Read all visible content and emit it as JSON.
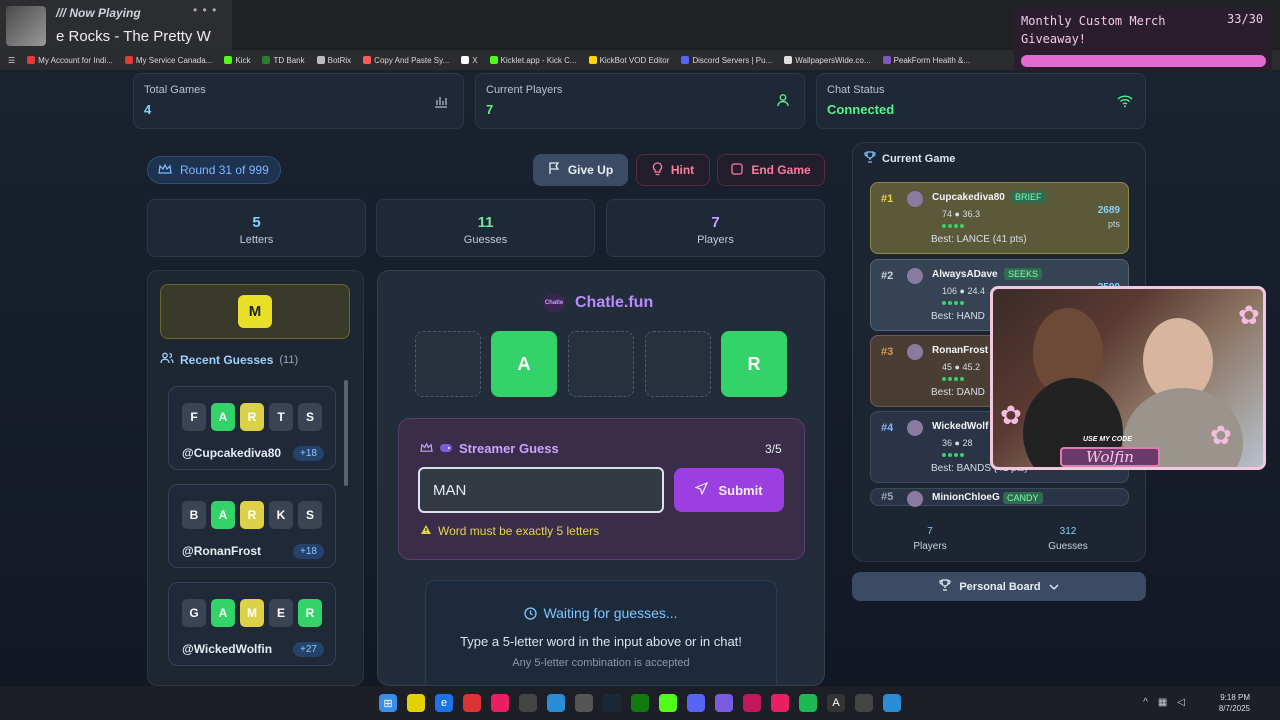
{
  "now_playing": {
    "label": "/// Now Playing",
    "song": "e Rocks - The Pretty W"
  },
  "bookmarks": [
    {
      "label": "My Account for Indi...",
      "color": "#e53935"
    },
    {
      "label": "My Service Canada...",
      "color": "#e53935"
    },
    {
      "label": "Kick",
      "color": "#53fc18"
    },
    {
      "label": "TD Bank",
      "color": "#2e7d32"
    },
    {
      "label": "BotRix",
      "color": "#bbbbbb"
    },
    {
      "label": "Copy And Paste Sy...",
      "color": "#ff5a5a"
    },
    {
      "label": "X",
      "color": "#ffffff"
    },
    {
      "label": "Kicklet.app - Kick C...",
      "color": "#53fc18"
    },
    {
      "label": "KickBot VOD Editor",
      "color": "#ffd600"
    },
    {
      "label": "Discord Servers | Pu...",
      "color": "#5865f2"
    },
    {
      "label": "WallpapersWide.co...",
      "color": "#dddddd"
    },
    {
      "label": "PeakForm Health &...",
      "color": "#7e57c2"
    }
  ],
  "merch": {
    "title": "Monthly Custom Merch Giveaway!",
    "count": "33/30",
    "progress": 1.0,
    "fill_color": "#e66bd0"
  },
  "stats": {
    "total_games": {
      "label": "Total Games",
      "value": "4"
    },
    "current_players": {
      "label": "Current Players",
      "value": "7"
    },
    "chat_status": {
      "label": "Chat Status",
      "value": "Connected",
      "color": "#5cf08a"
    }
  },
  "controls": {
    "round": "Round 31 of 999",
    "give_up": "Give Up",
    "hint": "Hint",
    "end_game": "End Game"
  },
  "info": [
    {
      "value": "5",
      "label": "Letters"
    },
    {
      "value": "11",
      "label": "Guesses"
    },
    {
      "value": "7",
      "label": "Players"
    }
  ],
  "known_letter": "M",
  "recent": {
    "title": "Recent Guesses",
    "count": "(11)",
    "guesses": [
      {
        "letters": [
          "F",
          "A",
          "R",
          "T",
          "S"
        ],
        "states": [
          "g",
          "gr",
          "y",
          "g",
          "g"
        ],
        "user": "@Cupcakediva80",
        "points": "+18"
      },
      {
        "letters": [
          "B",
          "A",
          "R",
          "K",
          "S"
        ],
        "states": [
          "g",
          "gr",
          "y",
          "g",
          "g"
        ],
        "user": "@RonanFrost",
        "points": "+18"
      },
      {
        "letters": [
          "G",
          "A",
          "M",
          "E",
          "R"
        ],
        "states": [
          "g",
          "gr",
          "y",
          "g",
          "gr"
        ],
        "user": "@WickedWolfin",
        "points": "+27"
      }
    ]
  },
  "brand": {
    "name": "Chatle.fun",
    "logo_text": "Chatle"
  },
  "word_slots": [
    "",
    "A",
    "",
    "",
    "R"
  ],
  "streamer_guess": {
    "title": "Streamer Guess",
    "count": "3/5",
    "input_value": "MAN",
    "submit": "Submit",
    "warning": "Word must be exactly 5 letters"
  },
  "waiting": {
    "title": "Waiting for guesses...",
    "sub": "Type a 5-letter word in the input above or in chat!",
    "sub2": "Any 5-letter combination is accepted"
  },
  "current_game": {
    "title": "Current Game",
    "entries": [
      {
        "rank": "#1",
        "name": "Cupcakediva80",
        "tag": "BRIEF",
        "stats": "74 ● 36.3",
        "score": "2689",
        "unit": "pts",
        "best": "Best: LANCE (41 pts)"
      },
      {
        "rank": "#2",
        "name": "AlwaysADave",
        "tag": "SEEKS",
        "stats": "106 ● 24.4",
        "score": "2590",
        "unit": "",
        "best": "Best: HAND"
      },
      {
        "rank": "#3",
        "name": "RonanFrost",
        "tag": "",
        "stats": "45 ● 45.2",
        "score": "",
        "unit": "",
        "best": "Best: DAND"
      },
      {
        "rank": "#4",
        "name": "WickedWolf",
        "tag": "",
        "stats": "36 ● 28",
        "score": "",
        "unit": "",
        "best": "Best: BANDS (41 pts)"
      },
      {
        "rank": "#5",
        "name": "MinionChloeG",
        "tag": "CANDY",
        "stats": "",
        "score": "",
        "unit": "",
        "best": ""
      }
    ],
    "players_value": "7",
    "players_label": "Players",
    "guesses_value": "312",
    "guesses_label": "Guesses"
  },
  "personal_board": "Personal Board",
  "cam": {
    "code_label": "USE MY CODE",
    "code_name": "Wolfin"
  },
  "clock": {
    "time": "9:18 PM",
    "date": "8/7/2025"
  }
}
